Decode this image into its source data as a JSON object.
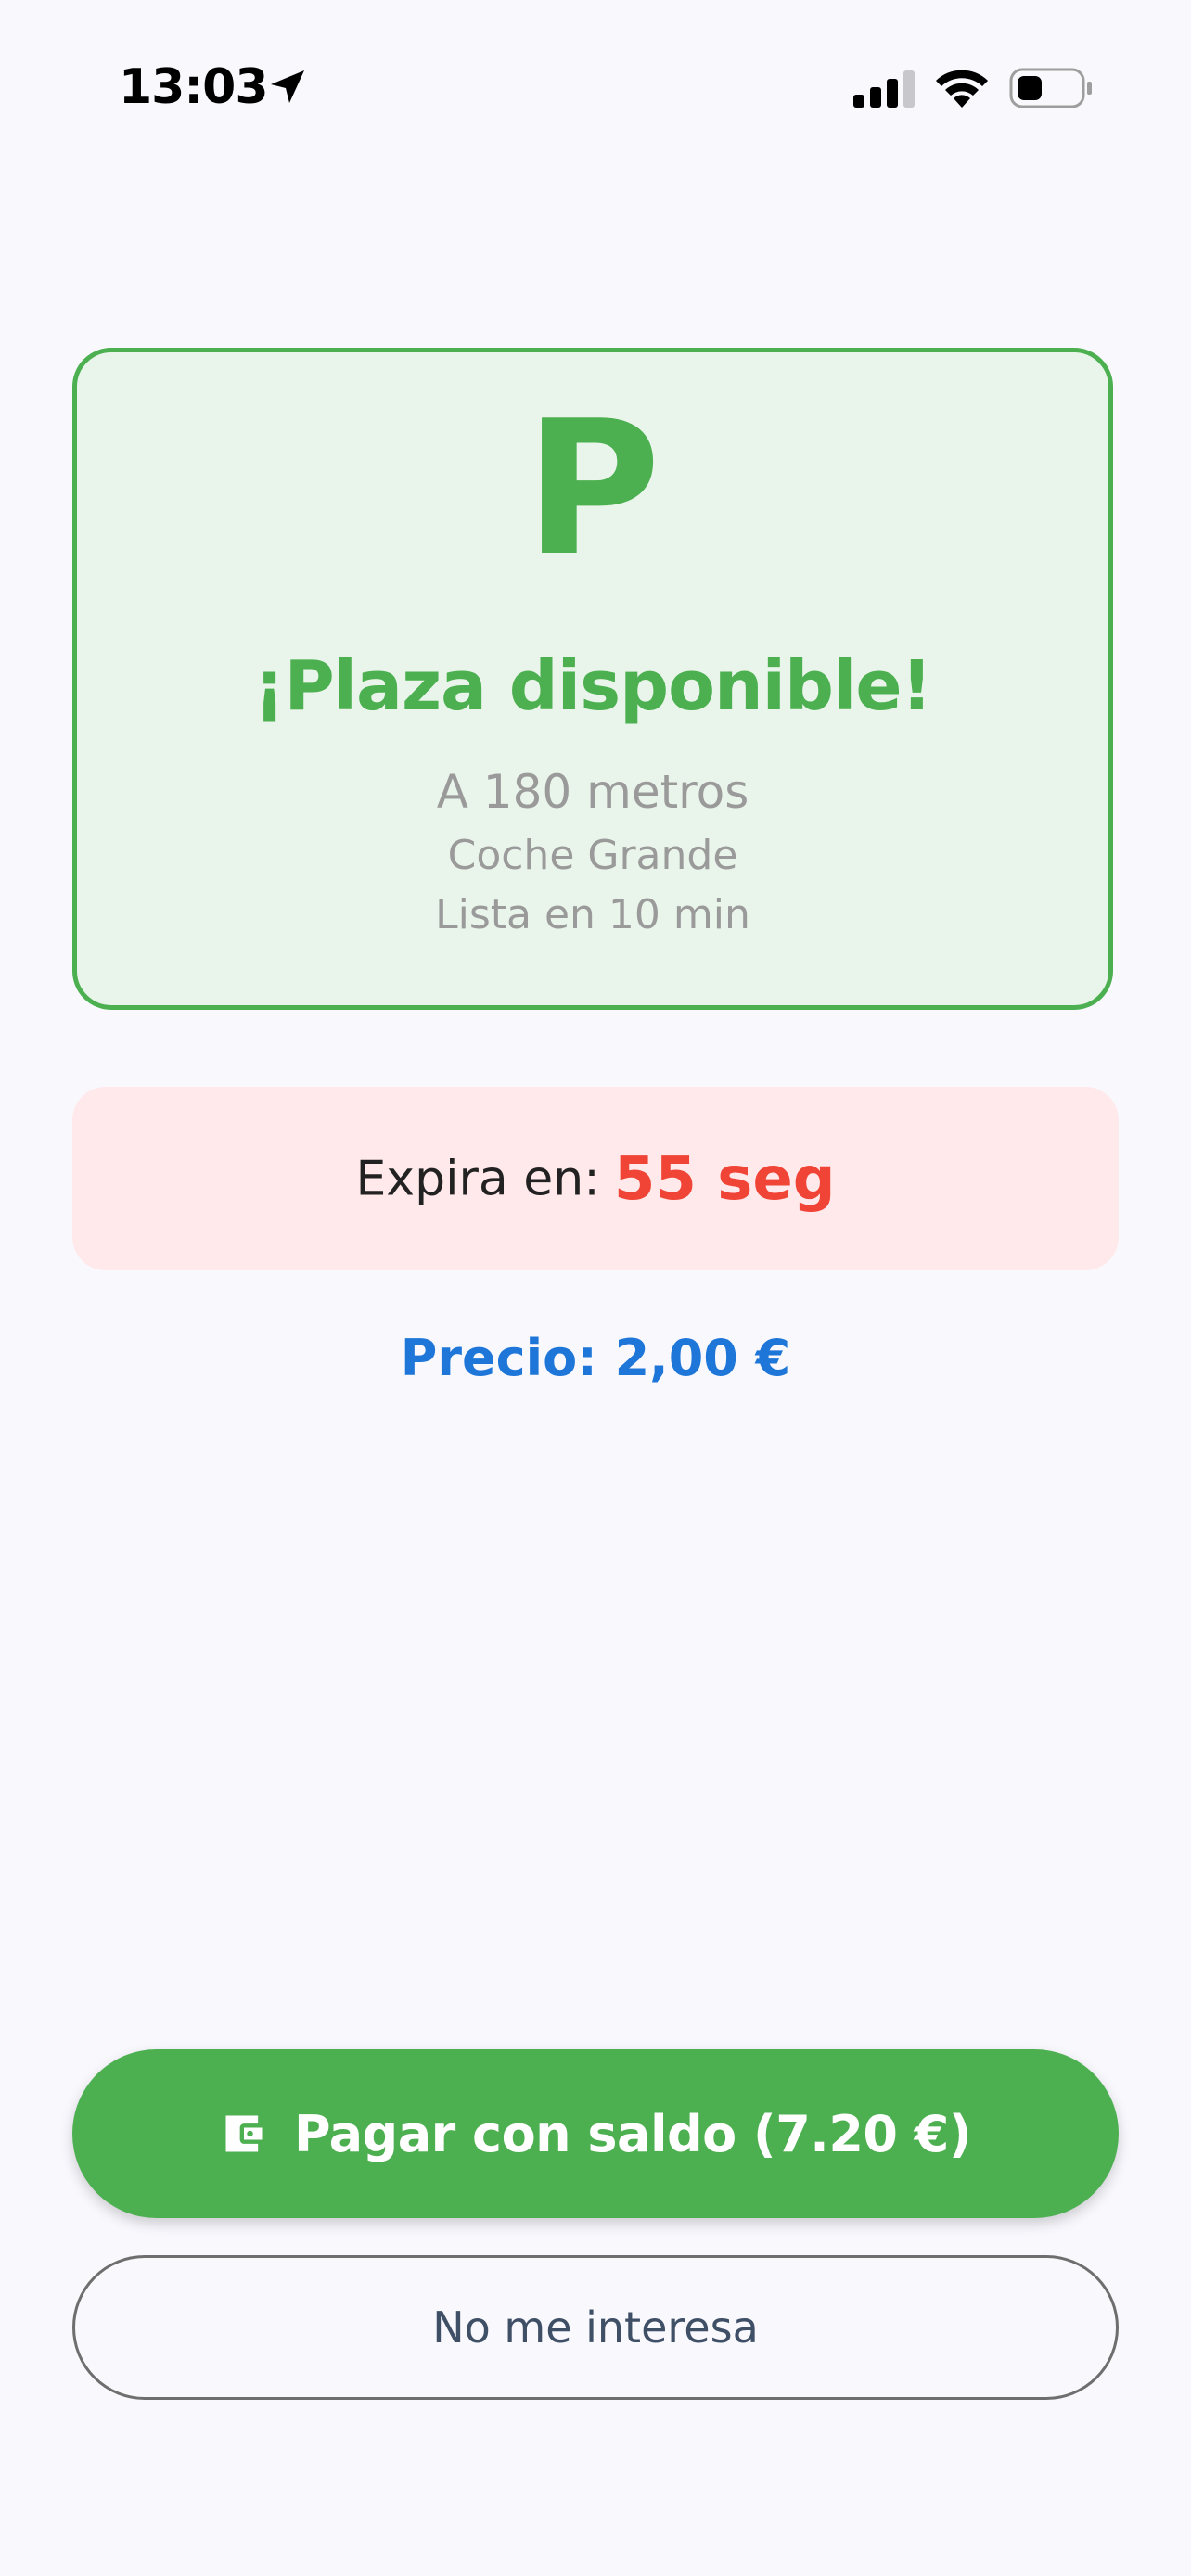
{
  "status_bar": {
    "time": "13:03",
    "icons": [
      "location-arrow-icon",
      "cellular-signal-icon",
      "wifi-icon",
      "battery-icon"
    ]
  },
  "spot_card": {
    "icon_letter": "P",
    "title": "¡Plaza disponible!",
    "distance": "A 180 metros",
    "vehicle_size": "Coche Grande",
    "ready_time": "Lista en 10 min"
  },
  "expiry": {
    "label": "Expira en:",
    "value": "55 seg"
  },
  "price": {
    "text": "Precio: 2,00 €"
  },
  "actions": {
    "pay_label": "Pagar con saldo (7.20 €)",
    "pay_icon": "wallet-icon",
    "decline_label": "No me interesa"
  },
  "colors": {
    "background": "#f8f8fd",
    "green": "#4caf50",
    "card_background": "#e9f5ea",
    "expiry_background": "#ffe9ea",
    "expiry_red": "#f04437",
    "price_blue": "#1e76d8",
    "muted_text": "#9a9a9a",
    "decline_text": "#3f4f66"
  }
}
